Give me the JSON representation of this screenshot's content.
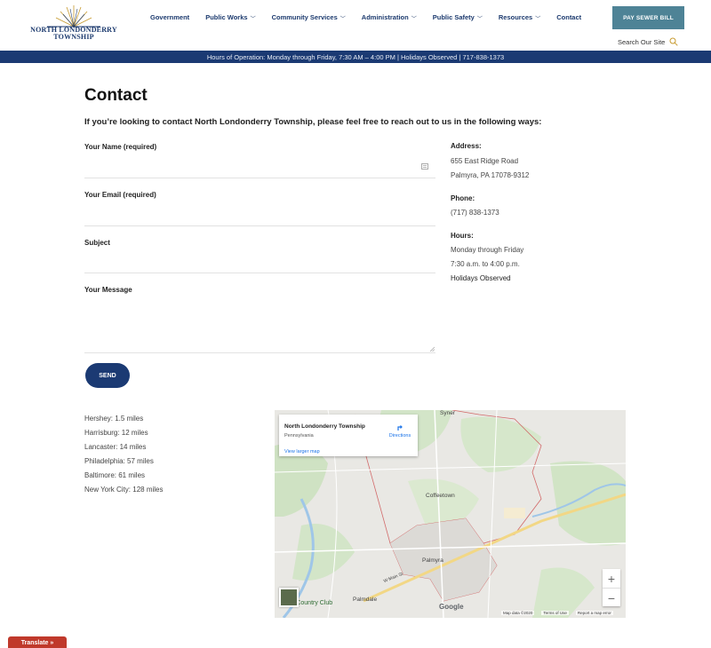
{
  "logo": {
    "line1": "NORTH LONDONDERRY",
    "line2": "TOWNSHIP"
  },
  "nav": {
    "items": [
      {
        "label": "Government",
        "dropdown": false
      },
      {
        "label": "Public Works",
        "dropdown": true
      },
      {
        "label": "Community Services",
        "dropdown": true
      },
      {
        "label": "Administration",
        "dropdown": true
      },
      {
        "label": "Public Safety",
        "dropdown": true
      },
      {
        "label": "Resources",
        "dropdown": true
      },
      {
        "label": "Contact",
        "dropdown": false
      }
    ]
  },
  "header": {
    "pay_button": "PAY SEWER BILL",
    "search_label": "Search Our Site"
  },
  "hours_bar": "Hours of Operation: Monday through Friday, 7:30 AM – 4:00 PM | Holidays Observed | 717-838-1373",
  "page": {
    "title": "Contact",
    "intro": "If you’re looking to contact North Londonderry Township, please feel free to reach out to us in the following ways:"
  },
  "form": {
    "name_label": "Your Name (required)",
    "email_label": "Your Email (required)",
    "subject_label": "Subject",
    "message_label": "Your Message",
    "name_value": "",
    "email_value": "",
    "subject_value": "",
    "message_value": "",
    "send_label": "SEND"
  },
  "contact_info": {
    "address_label": "Address:",
    "address_line1": "655 East Ridge Road",
    "address_line2": "Palmyra, PA 17078-9312",
    "phone_label": "Phone:",
    "phone": "(717) 838-1373",
    "hours_label": "Hours:",
    "hours_line1": "Monday through Friday",
    "hours_line2": "7:30 a.m. to 4:00 p.m.",
    "hours_line3": "Holidays Observed"
  },
  "distances": [
    "Hershey: 1.5 miles",
    "Harrisburg: 12 miles",
    "Lancaster: 14 miles",
    "Philadelphia: 57 miles",
    "Baltimore: 61 miles",
    "New York City: 128 miles"
  ],
  "map": {
    "card_title": "North Londonderry Township",
    "card_subtitle": "Pennsylvania",
    "card_link": "View larger map",
    "directions": "Directions",
    "places": {
      "syner": "Syner",
      "coffeetown": "Coffeetown",
      "palmyra": "Palmyra",
      "palmdale": "Palmdale",
      "country_club": "ey Country Club",
      "main_st": "W Main St"
    },
    "google": "Google",
    "footer": {
      "map_data": "Map data ©2020",
      "terms": "Terms of Use",
      "report": "Report a map error"
    },
    "zoom_in": "+",
    "zoom_out": "−"
  },
  "translate_label": "Translate »",
  "colors": {
    "navy": "#1b3a73",
    "teal_button": "#4e8396",
    "translate_red": "#c0392b"
  }
}
